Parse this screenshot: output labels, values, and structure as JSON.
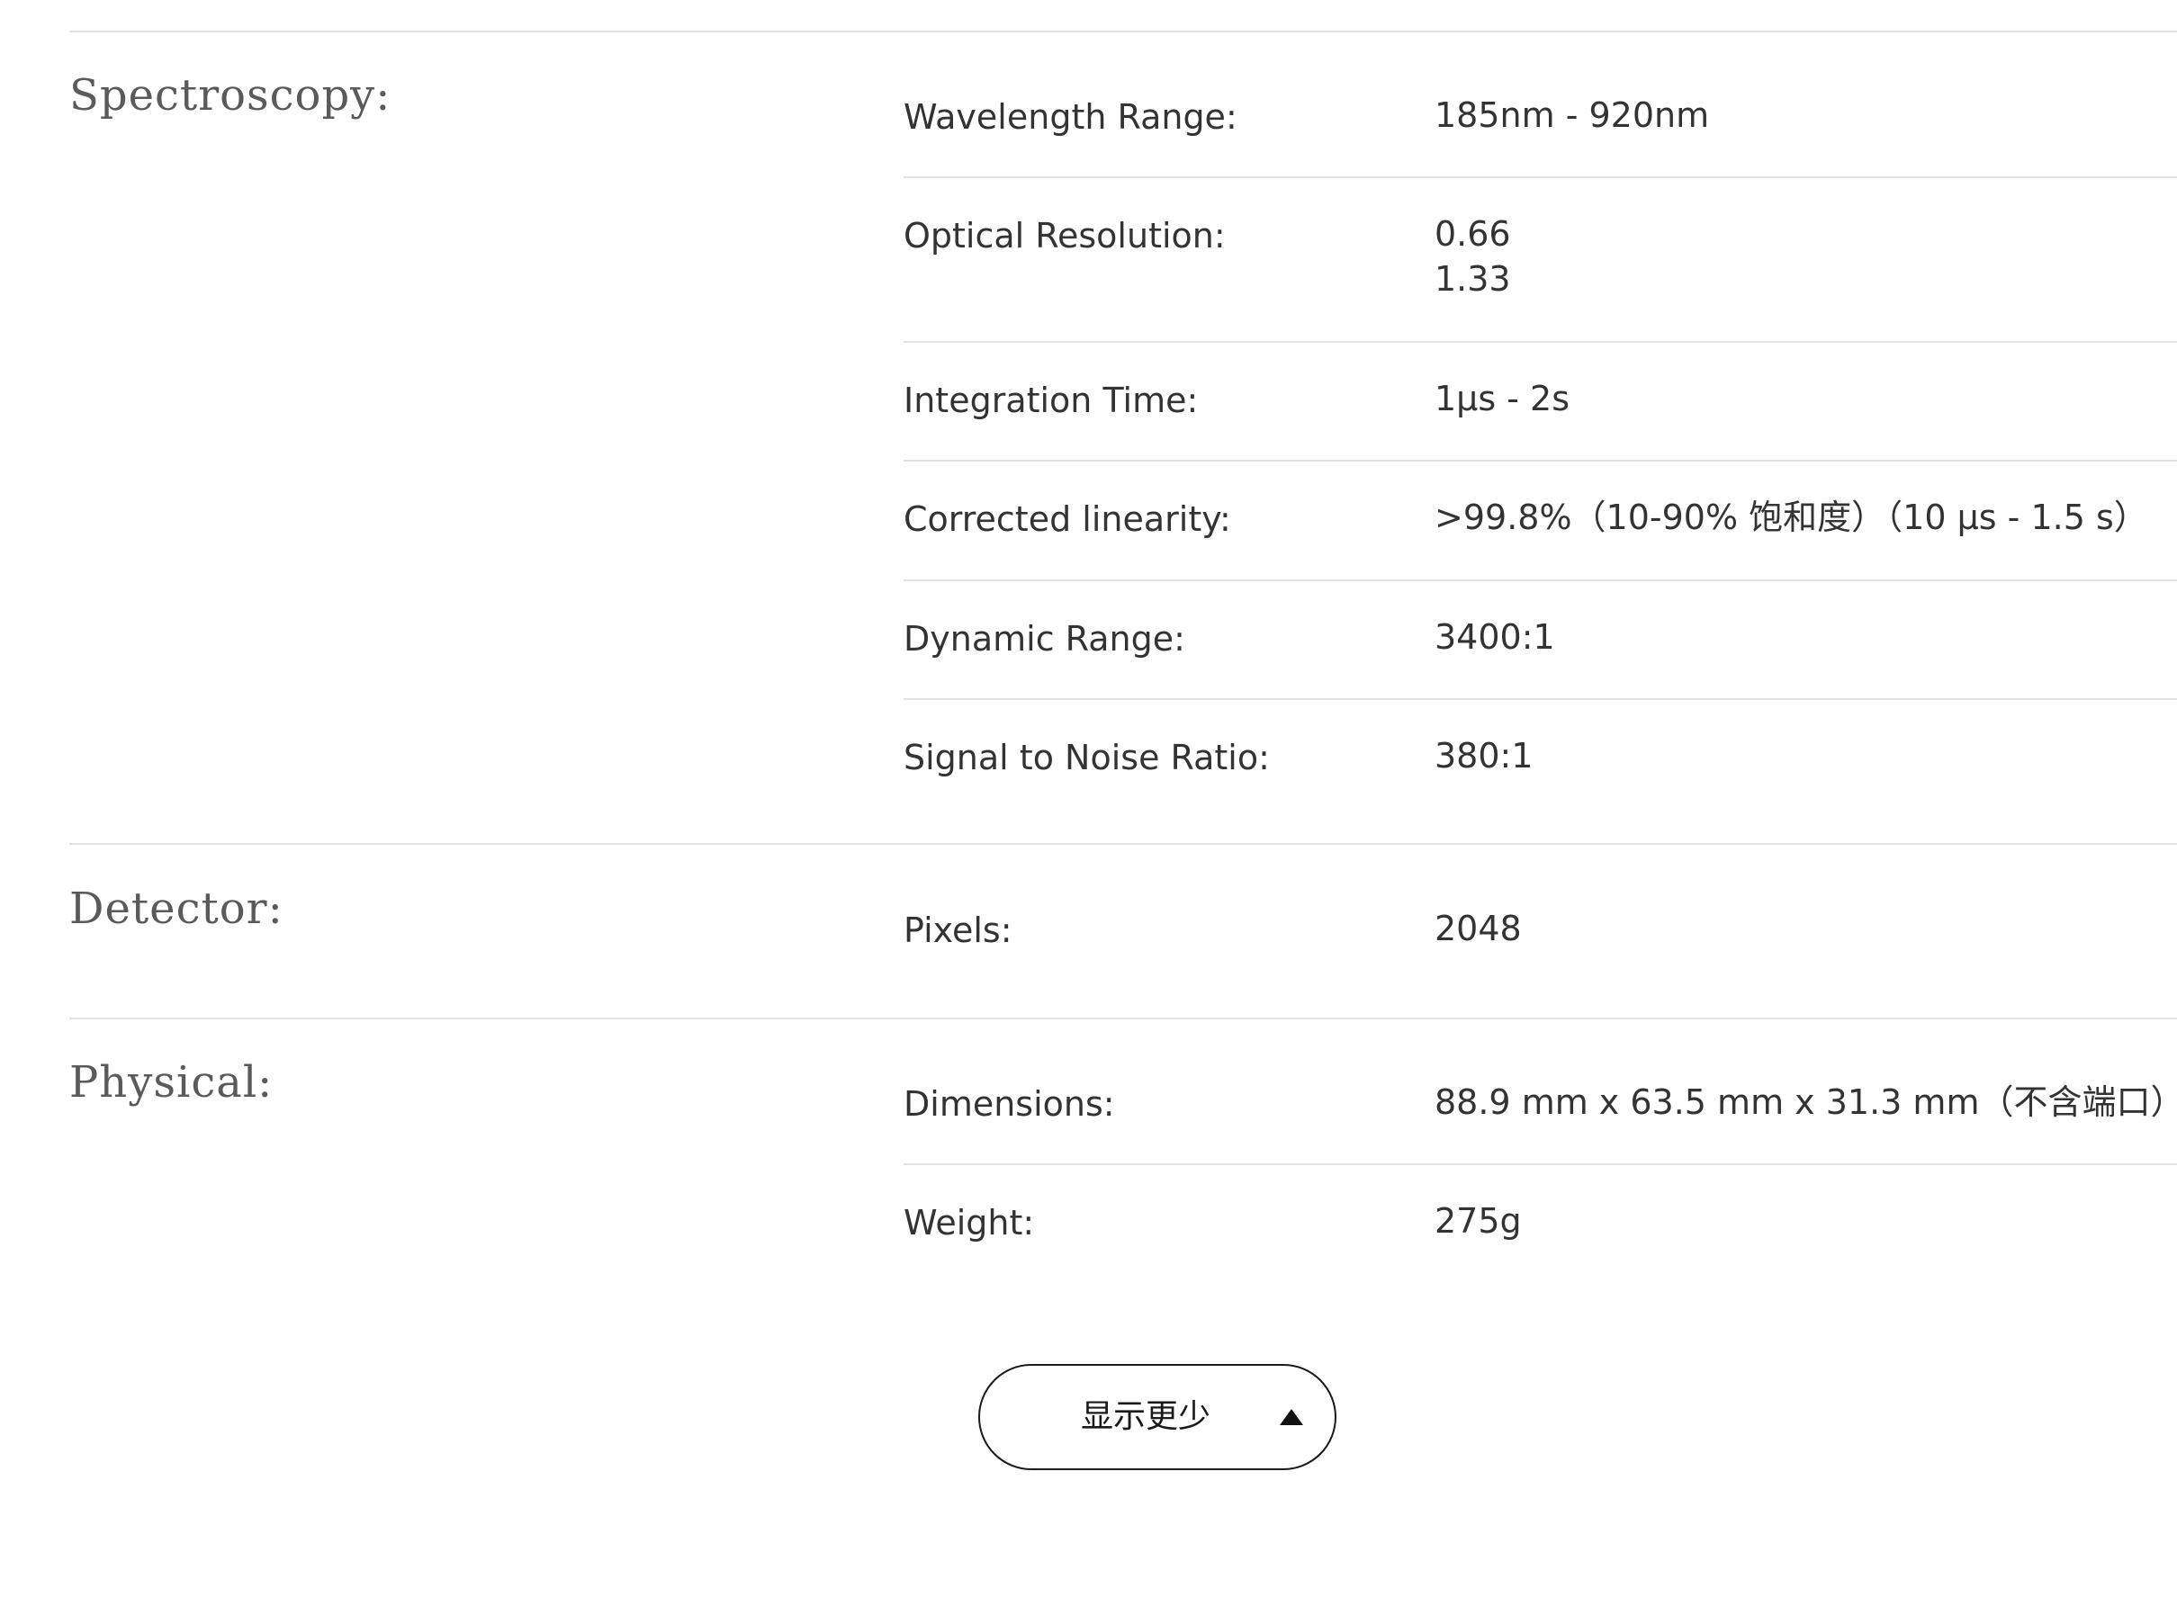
{
  "sections": [
    {
      "title": "Spectroscopy:",
      "rows": [
        {
          "label": "Wavelength Range:",
          "value": "185nm - 920nm"
        },
        {
          "label": "Optical Resolution:",
          "value_lines": [
            "0.66",
            "1.33"
          ]
        },
        {
          "label": "Integration Time:",
          "value": "1μs - 2s"
        },
        {
          "label": "Corrected linearity:",
          "value": ">99.8%（10-90% 饱和度）（10 μs - 1.5 s）"
        },
        {
          "label": "Dynamic Range:",
          "value": "3400:1"
        },
        {
          "label": "Signal to Noise Ratio:",
          "value": "380:1"
        }
      ]
    },
    {
      "title": "Detector:",
      "rows": [
        {
          "label": "Pixels:",
          "value": "2048"
        }
      ]
    },
    {
      "title": "Physical:",
      "rows": [
        {
          "label": "Dimensions:",
          "value": "88.9 mm x 63.5 mm x 31.3 mm（不含端口）"
        },
        {
          "label": "Weight:",
          "value": "275g"
        }
      ]
    }
  ],
  "toggle_button": {
    "label": "显示更少",
    "icon": "caret-up-icon"
  }
}
